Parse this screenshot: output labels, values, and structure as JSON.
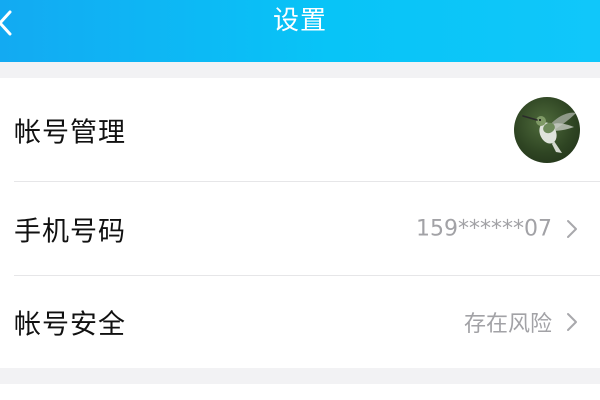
{
  "header": {
    "title": "设置",
    "background_color": "#13aaf2",
    "back_icon": "chevron-left-icon"
  },
  "settings": {
    "account": {
      "label": "帐号管理",
      "avatar": "hummingbird-avatar"
    },
    "phone": {
      "label": "手机号码",
      "value": "159******07",
      "icon": "chevron-right-icon"
    },
    "security": {
      "label": "帐号安全",
      "value": "存在风险",
      "icon": "chevron-right-icon"
    }
  },
  "colors": {
    "page_background": "#f2f2f4",
    "text_primary": "#111111",
    "text_secondary": "#a2a2a6"
  }
}
